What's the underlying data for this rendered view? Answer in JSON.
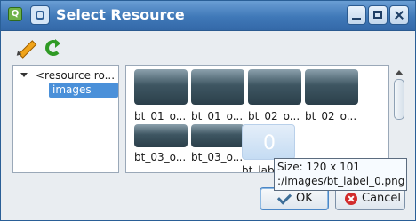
{
  "window": {
    "title": "Select Resource"
  },
  "toolbar": {
    "edit_icon": "pencil-icon",
    "reload_icon": "reload-icon"
  },
  "tree": {
    "root_label": "<resource ro...",
    "child_label": "images"
  },
  "thumbnails": [
    {
      "caption": "bt_01_o..."
    },
    {
      "caption": "bt_01_o..."
    },
    {
      "caption": "bt_02_o..."
    },
    {
      "caption": "bt_02_o..."
    },
    {
      "caption": "bt_03_o..."
    },
    {
      "caption": "bt_03_o..."
    },
    {
      "caption": "bt_label_0.png",
      "preview_text": "0"
    }
  ],
  "tooltip": {
    "line1": "Size: 120 x 101",
    "line2": ":/images/bt_label_0.png"
  },
  "buttons": {
    "ok": "OK",
    "cancel": "Cancel"
  }
}
